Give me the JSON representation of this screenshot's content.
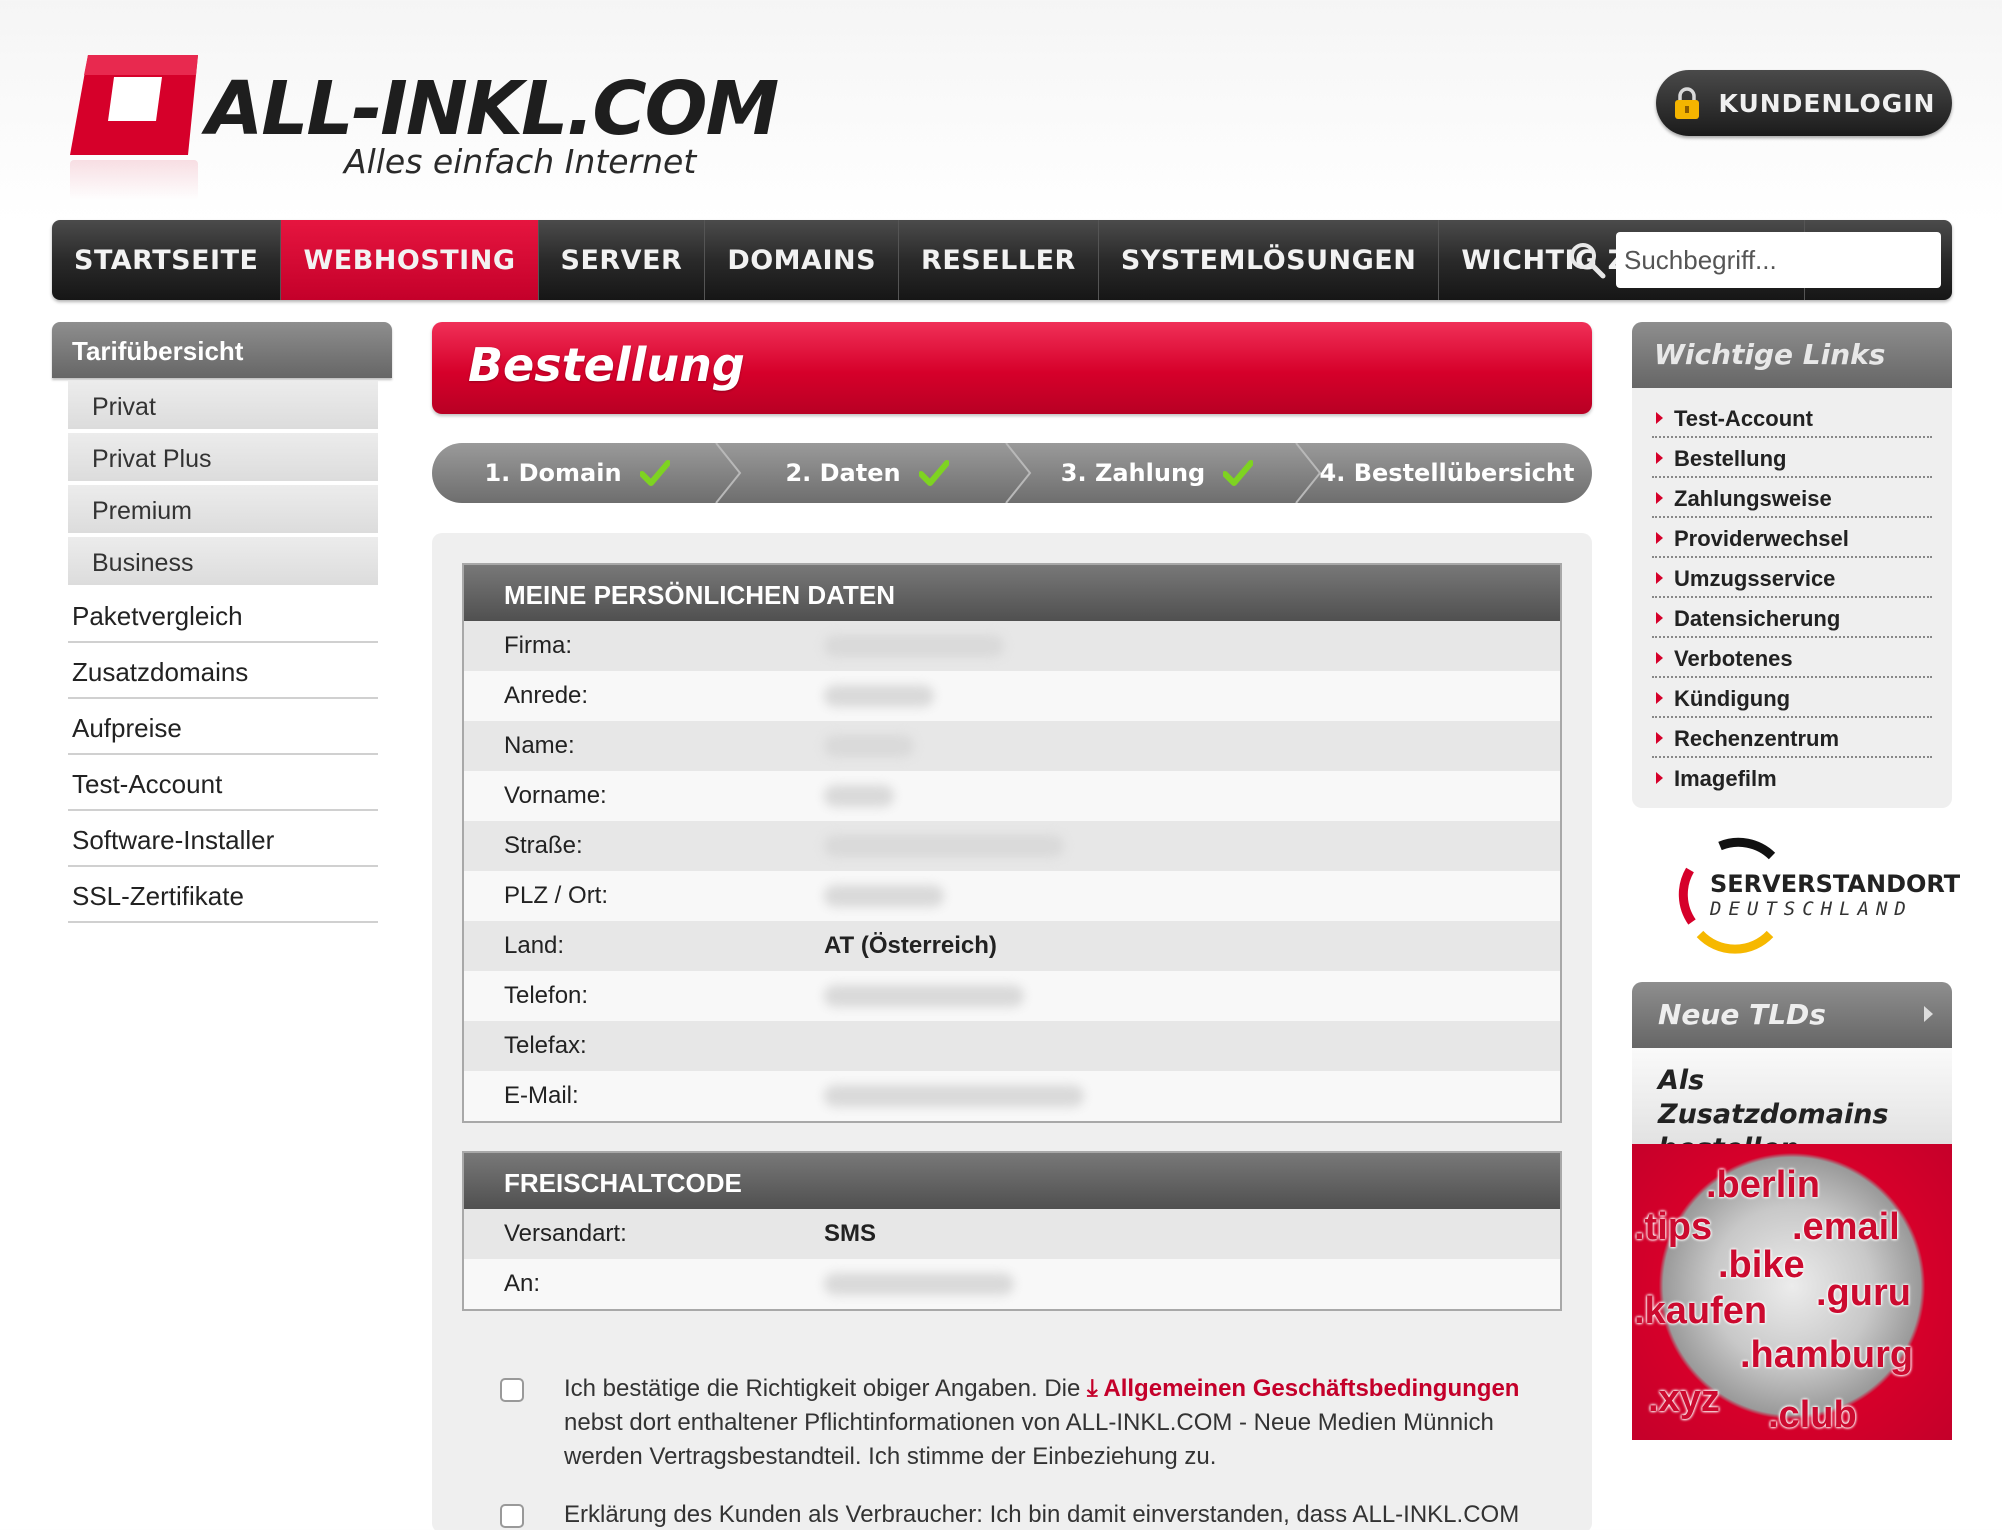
{
  "brand": {
    "name": "ALL-INKL.COM",
    "slogan": "Alles einfach Internet",
    "color": "#d6002a"
  },
  "header": {
    "login_label": "KUNDENLOGIN"
  },
  "nav": {
    "items": [
      "STARTSEITE",
      "WEBHOSTING",
      "SERVER",
      "DOMAINS",
      "RESELLER",
      "SYSTEMLÖSUNGEN",
      "WICHTIG ZU WISSEN"
    ],
    "active": "WEBHOSTING",
    "search_placeholder": "Suchbegriff..."
  },
  "left_sidebar": {
    "heading": "Tarifübersicht",
    "sub_items": [
      "Privat",
      "Privat Plus",
      "Premium",
      "Business"
    ],
    "links": [
      "Paketvergleich",
      "Zusatzdomains",
      "Aufpreise",
      "Test-Account",
      "Software-Installer",
      "SSL-Zertifikate"
    ]
  },
  "main": {
    "title": "Bestellung",
    "steps": [
      {
        "label": "1. Domain",
        "done": true
      },
      {
        "label": "2. Daten",
        "done": true
      },
      {
        "label": "3. Zahlung",
        "done": true
      },
      {
        "label": "4. Bestellübersicht",
        "done": false
      }
    ],
    "personal": {
      "heading": "MEINE PERSÖNLICHEN DATEN",
      "rows": [
        {
          "label": "Firma:",
          "value": ""
        },
        {
          "label": "Anrede:",
          "value": ""
        },
        {
          "label": "Name:",
          "value": ""
        },
        {
          "label": "Vorname:",
          "value": ""
        },
        {
          "label": "Straße:",
          "value": ""
        },
        {
          "label": "PLZ / Ort:",
          "value": ""
        },
        {
          "label": "Land:",
          "value": "AT (Österreich)"
        },
        {
          "label": "Telefon:",
          "value": ""
        },
        {
          "label": "Telefax:",
          "value": ""
        },
        {
          "label": "E-Mail:",
          "value": ""
        }
      ]
    },
    "code": {
      "heading": "FREISCHALTCODE",
      "rows": [
        {
          "label": "Versandart:",
          "value": "SMS"
        },
        {
          "label": "An:",
          "value": ""
        }
      ]
    },
    "consent1": {
      "pre": "Ich bestätige die Richtigkeit obiger Angaben. Die ",
      "link": "Allgemeinen Geschäftsbedingungen",
      "post": " nebst dort enthaltener Pflichtinformationen von ALL-INKL.COM - Neue Medien Münnich werden Vertragsbestandteil. Ich stimme der Einbeziehung zu."
    },
    "consent2": {
      "text": "Erklärung des Kunden als Verbraucher: Ich bin damit einverstanden, dass ALL-INKL.COM"
    }
  },
  "right_sidebar": {
    "heading": "Wichtige Links",
    "links": [
      "Test-Account",
      "Bestellung",
      "Zahlungsweise",
      "Providerwechsel",
      "Umzugsservice",
      "Datensicherung",
      "Verbotenes",
      "Kündigung",
      "Rechenzentrum",
      "Imagefilm"
    ],
    "server_badge": {
      "line1": "SERVERSTANDORT",
      "line2": "DEUTSCHLAND"
    },
    "tld": {
      "heading": "Neue TLDs",
      "sub": "Als Zusatzdomains bestellen",
      "items": [
        ".berlin",
        ".tips",
        ".email",
        ".bike",
        ".guru",
        ".kaufen",
        ".hamburg",
        ".xyz",
        ".club"
      ]
    }
  }
}
